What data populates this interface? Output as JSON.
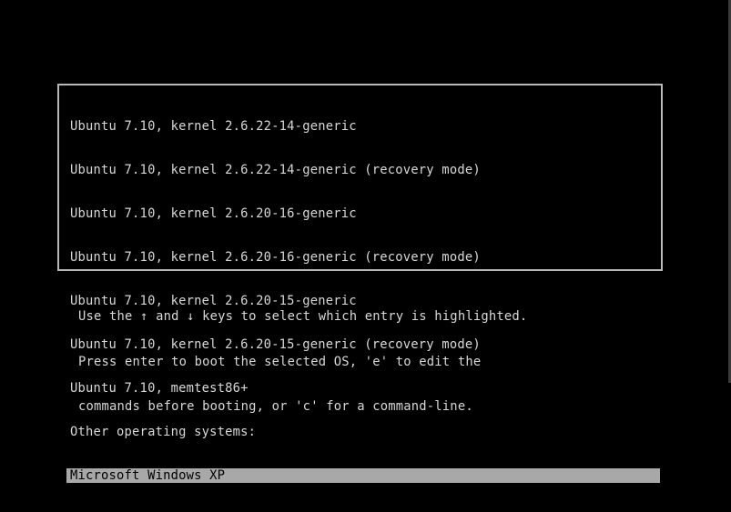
{
  "boot_menu": {
    "entries": [
      {
        "label": "Ubuntu 7.10, kernel 2.6.22-14-generic",
        "selected": false
      },
      {
        "label": "Ubuntu 7.10, kernel 2.6.22-14-generic (recovery mode)",
        "selected": false
      },
      {
        "label": "Ubuntu 7.10, kernel 2.6.20-16-generic",
        "selected": false
      },
      {
        "label": "Ubuntu 7.10, kernel 2.6.20-16-generic (recovery mode)",
        "selected": false
      },
      {
        "label": "Ubuntu 7.10, kernel 2.6.20-15-generic",
        "selected": false
      },
      {
        "label": "Ubuntu 7.10, kernel 2.6.20-15-generic (recovery mode)",
        "selected": false
      },
      {
        "label": "Ubuntu 7.10, memtest86+",
        "selected": false
      },
      {
        "label": "Other operating systems:",
        "selected": false
      },
      {
        "label": "Microsoft Windows XP",
        "selected": true
      }
    ]
  },
  "help_text": {
    "line1": "Use the ↑ and ↓ keys to select which entry is highlighted.",
    "line2": "Press enter to boot the selected OS, 'e' to edit the",
    "line3": "commands before booting, or 'c' for a command-line."
  },
  "colors": {
    "background": "#000000",
    "text": "#d8d8d8",
    "highlight_bg": "#a8a8a8",
    "highlight_text": "#000000",
    "border": "#b8b8b8"
  }
}
